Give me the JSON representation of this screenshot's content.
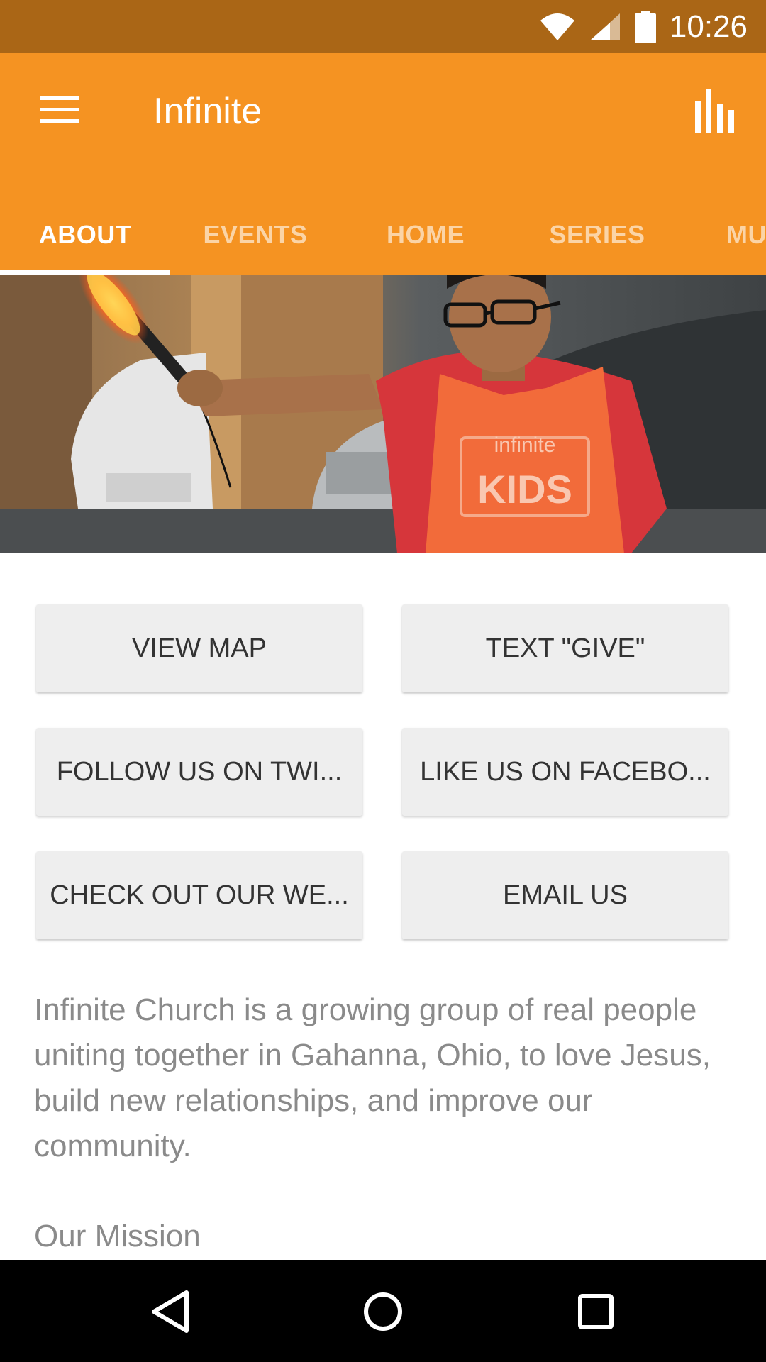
{
  "status_bar": {
    "time": "10:26",
    "icons": [
      "wifi-icon",
      "cell-signal-icon",
      "battery-icon"
    ]
  },
  "app_bar": {
    "title": "Infinite",
    "menu_icon": "hamburger-menu-icon",
    "action_icon": "bar-chart-icon",
    "background_color": "#F59322"
  },
  "tabs": [
    {
      "label": "ABOUT",
      "active": true
    },
    {
      "label": "EVENTS",
      "active": false
    },
    {
      "label": "HOME",
      "active": false
    },
    {
      "label": "SERIES",
      "active": false
    },
    {
      "label": "MU",
      "active": false
    }
  ],
  "hero": {
    "vest_text_line1": "infinite",
    "vest_text_line2": "KIDS"
  },
  "buttons": [
    {
      "label": "VIEW MAP"
    },
    {
      "label": "TEXT \"GIVE\""
    },
    {
      "label": "FOLLOW US ON TWI..."
    },
    {
      "label": "LIKE US ON FACEBO..."
    },
    {
      "label": "CHECK OUT OUR WE..."
    },
    {
      "label": "EMAIL US"
    }
  ],
  "about": {
    "text": "Infinite Church is a growing group of real people uniting together in Gahanna, Ohio, to love Jesus, build new relationships, and improve our community.",
    "mission_heading": "Our Mission"
  },
  "nav_bar": {
    "icons": [
      "back-icon",
      "home-icon",
      "recents-icon"
    ]
  }
}
